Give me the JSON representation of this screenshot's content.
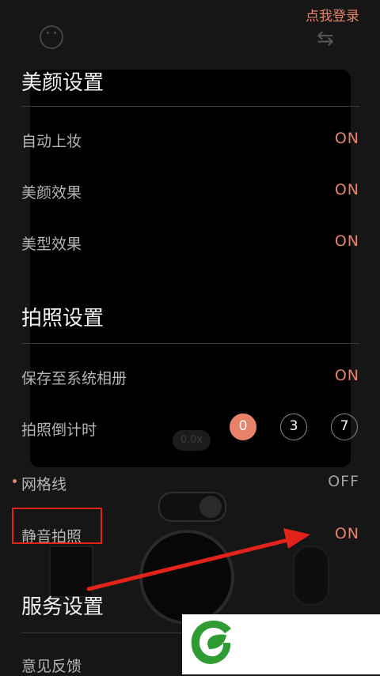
{
  "header": {
    "login_link": "点我登录"
  },
  "sections": {
    "beauty": {
      "title": "美颜设置",
      "rows": [
        {
          "label": "自动上妆",
          "value": "ON"
        },
        {
          "label": "美颜效果",
          "value": "ON"
        },
        {
          "label": "美型效果",
          "value": "ON"
        }
      ]
    },
    "photo": {
      "title": "拍照设置",
      "save_row": {
        "label": "保存至系统相册",
        "value": "ON"
      },
      "timer_row": {
        "label": "拍照倒计时",
        "options": [
          "0",
          "3",
          "7"
        ],
        "selected": "0"
      },
      "grid_row": {
        "label": "网格线",
        "value": "OFF"
      },
      "silent_row": {
        "label": "静音拍照",
        "value": "ON"
      }
    },
    "service": {
      "title": "服务设置",
      "feedback_row": {
        "label": "意见反馈"
      }
    }
  },
  "camera": {
    "zoom_label": "0.0x"
  },
  "colors": {
    "accent": "#e8826a",
    "highlight_red": "#e2231a",
    "logo_green": "#2e9b33"
  },
  "icons": {
    "top_left": "face-icon",
    "top_right": "swap-camera-icon",
    "logo": "leaf-logo-icon"
  }
}
